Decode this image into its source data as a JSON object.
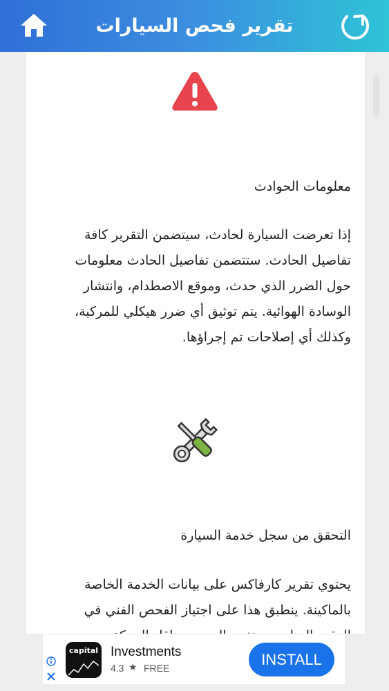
{
  "header": {
    "title": "تقرير فحص السيارات",
    "home_icon": "home-icon",
    "refresh_icon": "refresh-icon"
  },
  "sections": [
    {
      "icon": "warning-icon",
      "heading": "معلومات الحوادث",
      "lines": [
        "إذا تعرضت السيارة لحادث، سيتضمن التقرير كافة",
        "تفاصيل الحادث. ستتضمن تفاصيل الحادث معلومات",
        "حول الضرر الذي حدث، وموقع الاصطدام، وانتشار",
        "الوسادة الهوائية. يتم توثيق أي ضرر هيكلي للمركبة،",
        "وكذلك أي إصلاحات تم إجراؤها."
      ]
    },
    {
      "icon": "wrench-screwdriver-icon",
      "heading": "التحقق من سجل خدمة السيارة",
      "lines": [
        "يحتوي تقرير كارفاكس على بيانات الخدمة الخاصة",
        "بالماكينة. ينطبق هذا على اجتياز الفحص الفني في",
        "الوقت المناسب وتغيير الزيت ومناقل الحركة"
      ]
    }
  ],
  "ad": {
    "logo_text": "capital",
    "title": "Investments",
    "rating": "4.3",
    "store_label": "FREE",
    "install_label": "INSTALL",
    "colors": {
      "install": "#1a73e8",
      "close": "#1a73e8"
    }
  },
  "colors": {
    "header_start": "#2f6fd6",
    "header_end": "#2ec4d6",
    "warning": "#e8444d",
    "screwdriver_handle": "#7cb342"
  }
}
